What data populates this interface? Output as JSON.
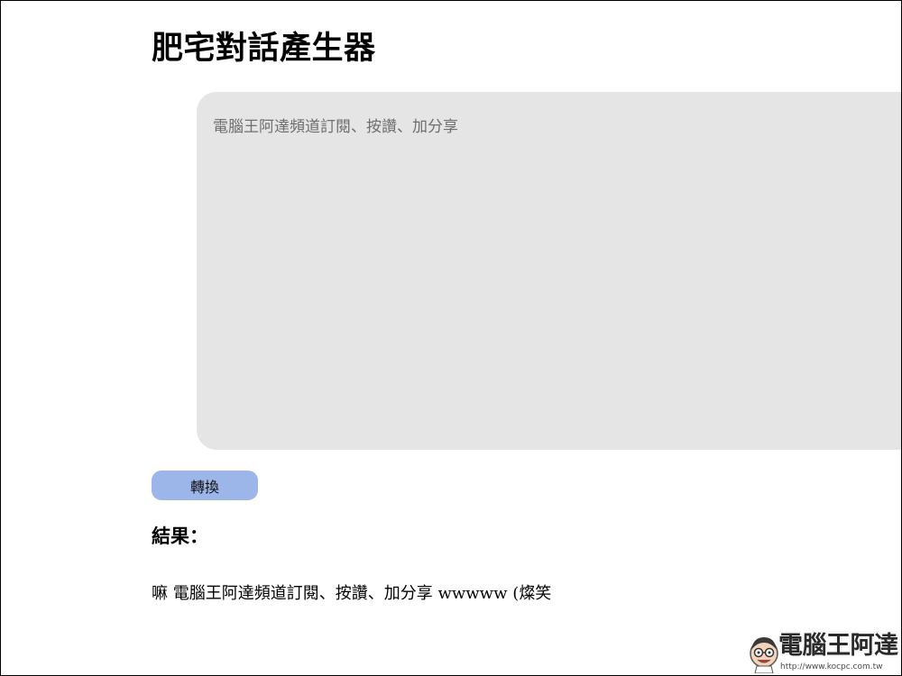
{
  "page": {
    "title": "肥宅對話產生器"
  },
  "input": {
    "value": "",
    "placeholder": "電腦王阿達頻道訂閱、按讚、加分享"
  },
  "convert_button": {
    "label": "轉換"
  },
  "result": {
    "heading": "結果：",
    "text": "嘛 電腦王阿達頻道訂閱、按讚、加分享 wwwww (燦笑"
  },
  "watermark": {
    "title": "電腦王阿達",
    "url": "http://www.kocpc.com.tw"
  },
  "colors": {
    "input_background": "#e5e5e5",
    "button_background": "#9db6e9"
  }
}
